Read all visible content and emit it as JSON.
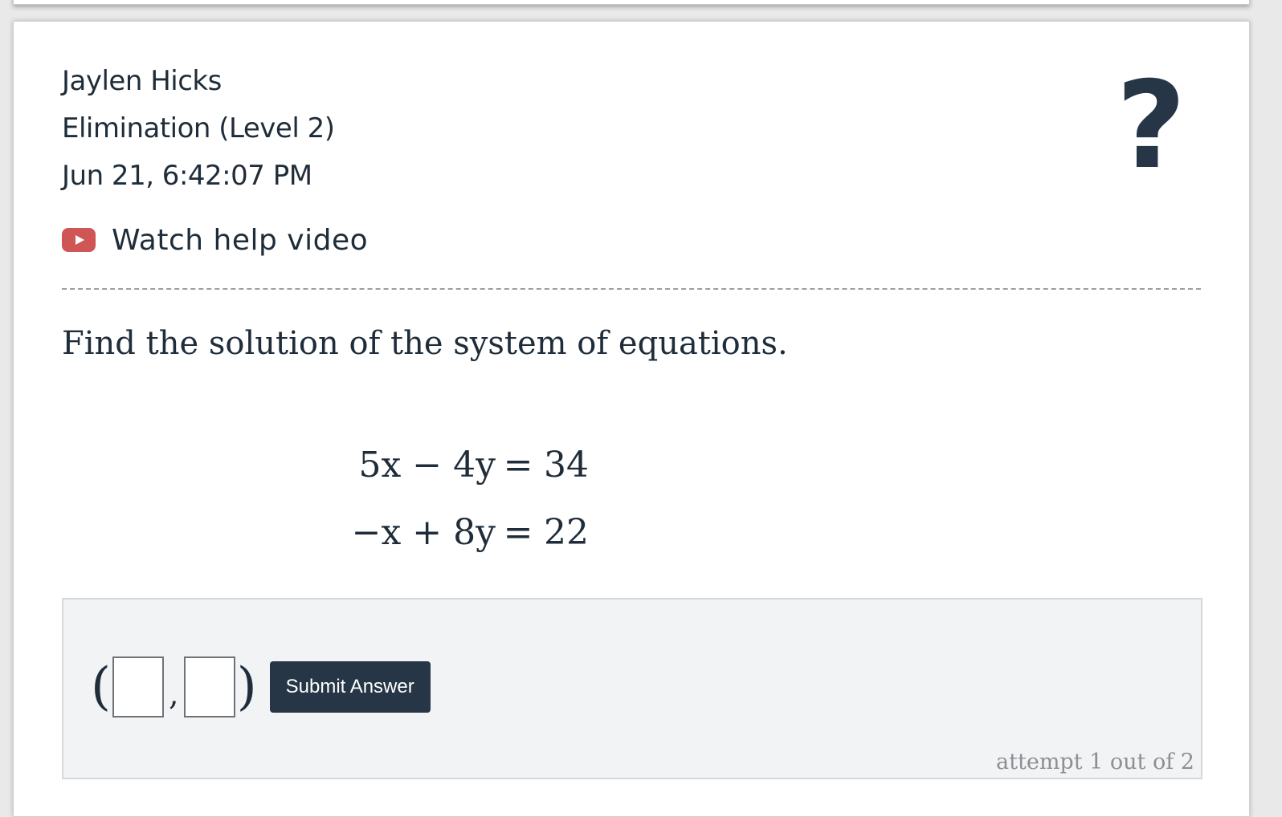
{
  "header": {
    "student_name": "Jaylen Hicks",
    "assignment": "Elimination (Level 2)",
    "timestamp": "Jun 21, 6:42:07 PM",
    "help_icon": "question-mark-icon",
    "video_link_label": "Watch help video",
    "video_icon": "youtube-play-icon"
  },
  "question": {
    "prompt": "Find the solution of the system of equations.",
    "equations": [
      {
        "left": "5x − 4y",
        "right": "34"
      },
      {
        "left": "−x + 8y",
        "right": "22"
      }
    ]
  },
  "answer": {
    "open_paren": "(",
    "comma": ",",
    "close_paren": ")",
    "x_value": "",
    "y_value": "",
    "submit_label": "Submit Answer",
    "attempt_text": "attempt 1 out of 2"
  },
  "colors": {
    "text": "#1f2d3a",
    "button": "#263646",
    "video_icon": "#d05555",
    "answer_bg": "#f2f3f5"
  }
}
